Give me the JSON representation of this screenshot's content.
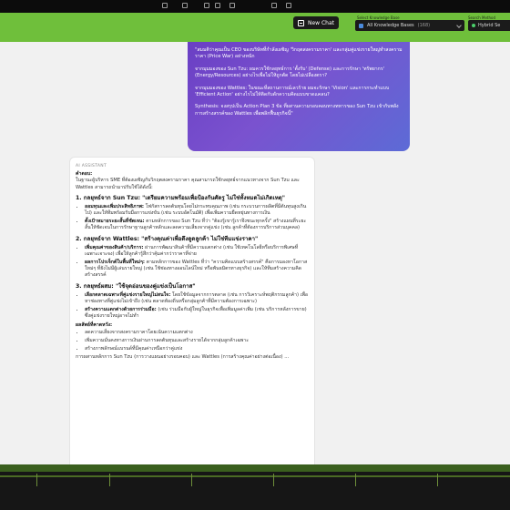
{
  "app": {
    "brand": "",
    "new_chat_label": "New Chat"
  },
  "kb": {
    "label": "Select Knowledge Base",
    "value": "All Knowledge Bases",
    "count": "(168)"
  },
  "search_method": {
    "label": "Search Method",
    "value": "Hybrid Se"
  },
  "user_message": {
    "lines": [
      "\"สมมติว่าคุณเป็น CEO ของบริษัทที่กำลังเผชิญ 'วิกฤตสงครามราคา' และกลุ่มคู่แข่งรายใหญ่ทำสงครามราคา (Price War) อย่างหนัก",
      "จากมุมมองของ Sun Tzu: ผมควรใช้กลยุทธ์การ 'ตั้งรับ' (Defense) และการรักษา 'ทรัพยากร' (Energy/Resources) อย่างไรเพื่อไม่ให้ถูกตัด โดยไม่เปลืองตรา?",
      "จากมุมมองของ Wattles: ในขณะที่สถานการณ์เลวร้าย ผมจะรักษา 'Vision' และการกระทำแบบ 'Efficient Action' อย่างไรไม่ให้ติดกับดักความคิดแบบขาดแคลน?",
      "Synthesis: จงสรุปเป็น Action Plan 3 ข้อ ที่ผสานความรอบคอบทางทหารของ Sun Tzu เข้ากับพลังการสร้างสรรค์ของ Wattles เพื่อพลิกฟื้นธุรกิจนี้\""
    ]
  },
  "ai": {
    "label": "AI ASSISTANT",
    "answer_label": "คำตอบ:",
    "intro": "ในฐานะผู้บริหาร SME ที่ต้องเผชิญกับวิกฤตสงครามราคา คุณสามารถใช้กลยุทธ์จากแนวทางจาก Sun Tzu และ Wattles สามารถนำมาปรับใช้ได้ดังนี้:",
    "sections": [
      {
        "title": "1. กลยุทธ์จาก Sun Tzu: \"เตรียมความพร้อมเพื่อป้องกันศัตรู ไม่ใช่ทั้งหมดไม่เกิดเหตุ\"",
        "items": [
          {
            "head": "ออมทุนและเพิ่มประสิทธิภาพ:",
            "body": "โฟกัสการลดต้นทุนโดยไม่กระทบคุณภาพ (เช่น กระบวนการผลิตที่มีต้นทุนสูงเกินไป) และให้ทีมพร้อมรับมือการแข่งขัน (เช่น ระบบอัตโนมัติ) เพื่อเพิ่มความยืดหยุ่นทางการเงิน"
          },
          {
            "head": "ตั้งเป้าหมายระยะสั้นที่ชัดเจน:",
            "body": "ตามหลักการของ Sun Tzu ที่ว่า \"ต้องรู้เขารู้เราจึงชนะทุกครั้ง\" สร้างแผนที่ระยะสั้นให้ชัดเจนในการรักษาฐานลูกค้าหลักและลดความเสี่ยงจากคู่แข่ง (เช่น ลูกค้าที่ต้องการบริการส่วนบุคคล)"
          }
        ]
      },
      {
        "title": "2. กลยุทธ์จาก Wattles: \"สร้างคุณค่าเพื่อดึงดูดลูกค้า ไม่ใช่ทีมแข่งราคา\"",
        "items": [
          {
            "head": "เพิ่มคุณค่าของสินค้า/บริการ:",
            "body": "ผ่านการพัฒนาสินค้าที่มีความแตกต่าง (เช่น ใช้เทคโนโลยีหรือบริการพิเศษที่เฉพาะเจาะจง) เพื่อให้ลูกค้ารู้สึกว่าคุ้มค่ากว่าราคาที่จ่าย"
          },
          {
            "head": "ผลการโปรเจ็กต์ในพื้นที่ใหม่ๆ:",
            "body": "ตามหลักการของ Wattles ที่ว่า \"ความคิดแบบสร้างสรรค์\" คือการมองหาโอกาสใหม่ๆ ที่ยังไม่มีผู้เล่นรายใหญ่ (เช่น ใช้ช่องทางออนไลน์ใหม่ หรือพันธมิตรทางธุรกิจ) และให้ทีมสร้างความคิดสร้างสรรค์"
          }
        ]
      },
      {
        "title": "3. กลยุทธ์ผสม: \"ใช้จุดอ่อนของคู่แข่งเป็นโอกาส\"",
        "items": [
          {
            "head": "เลือกตลาดเฉพาะที่คู่แข่งรายใหญ่ไม่สนใจ:",
            "body": "โดยใช้ข้อมูลจากการตลาด (เช่น การวิเคราะห์พฤติกรรมลูกค้า) เพื่อหาช่องทางที่คู่แข่งไม่เข้าถึง (เช่น ตลาดท้องถิ่นหรือกลุ่มลูกค้าที่มีความต้องการเฉพาะ)"
          },
          {
            "head": "สร้างความแตกต่างด้วยการร่วมมือ:",
            "body": "(เช่น ร่วมมือกับผู้ใหญ่ในธุรกิจเพื่อเพิ่มมูลค่าเพิ่ม (เช่น บริการหลังการขาย) ซึ่งคู่แข่งรายใหญ่อาจไม่ทำ"
          }
        ]
      }
    ],
    "results_title": "ผลลัพธ์ที่คาดหวัง:",
    "results": [
      "ลดความเสี่ยงจากสงครามราคาโดยเน้นความแตกต่าง",
      "เพิ่มความมั่นคงทางการเงินผ่านการลดต้นทุนและสร้างรายได้จากกลุ่มลูกค้าเฉพาะ",
      "สร้างภาพลักษณ์แบรนด์ที่มีคุณค่าเหนือกว่าคู่แข่ง"
    ],
    "tail": "การผสานหลักการ Sun Tzu (การวางแผนอย่างรอบคอบ) และ Wattles (การสร้างคุณค่าอย่างต่อเนื่อง) ..."
  },
  "colors": {
    "header": "#6fbf3b",
    "bubble_start": "#6a3fc4",
    "bubble_end": "#5c6bd6"
  }
}
